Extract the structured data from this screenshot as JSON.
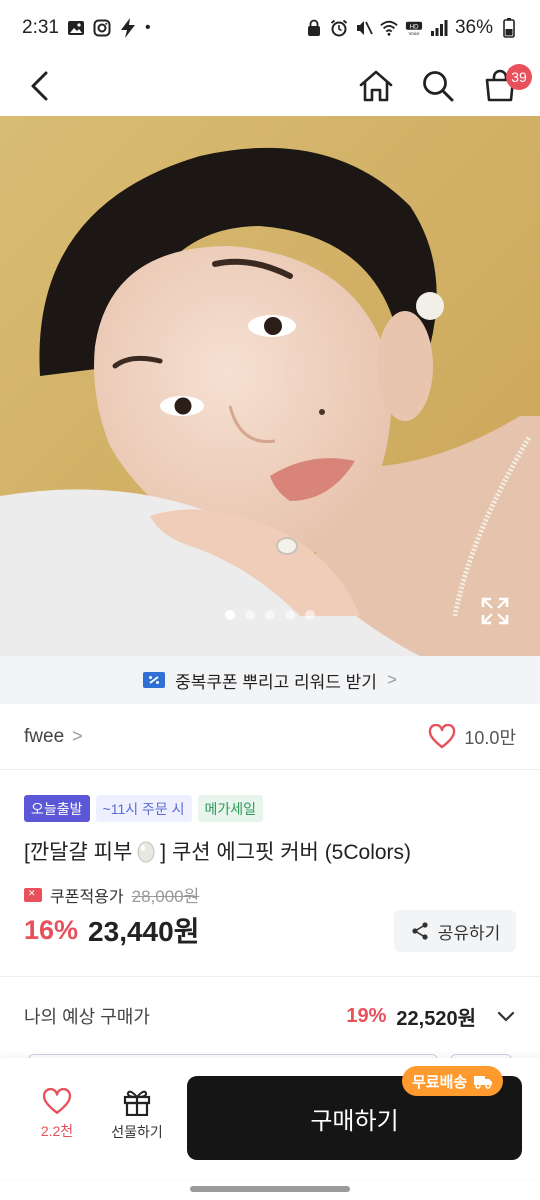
{
  "status_bar": {
    "time": "2:31",
    "battery": "36%",
    "dot": "•"
  },
  "header": {
    "cart_count": "39"
  },
  "hero": {
    "slide_count": 5,
    "active_slide": 1
  },
  "coupon_banner": {
    "text": "중복쿠폰 뿌리고 리워드 받기",
    "chevron": ">"
  },
  "brand": {
    "name": "fwee",
    "chevron": ">",
    "likes": "10.0만"
  },
  "badges": [
    "오늘출발",
    "~11시 주문 시",
    "메가세일"
  ],
  "product": {
    "title_prefix": "[깐달걀 피부",
    "title_suffix": "] 쿠션 에그핏 커버 (5Colors)",
    "coupon_label": "쿠폰적용가",
    "original_price": "28,000원",
    "discount": "16%",
    "price": "23,440원",
    "share_label": "공유하기"
  },
  "estimate": {
    "label": "나의 예상 구매가",
    "discount": "19%",
    "price": "22,520원"
  },
  "bottom_bar": {
    "like_count": "2.2천",
    "gift_label": "선물하기",
    "buy_label": "구매하기",
    "free_ship_label": "무료배송"
  },
  "colors": {
    "accent_red": "#e8505b",
    "buy_button": "#151515",
    "free_ship": "#ff9a2e"
  }
}
